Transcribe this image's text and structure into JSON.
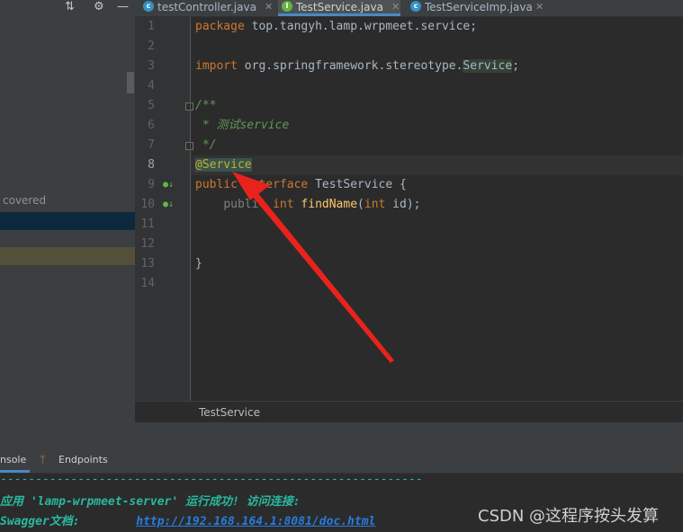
{
  "tabs": [
    {
      "label": "testController.java",
      "icon": "class-icon",
      "active": false
    },
    {
      "label": "TestService.java",
      "icon": "interface-icon",
      "active": true
    },
    {
      "label": "TestServiceImp.java",
      "icon": "class-icon",
      "active": false
    }
  ],
  "left_panel": {
    "covered_label": "covered"
  },
  "line_numbers": [
    "1",
    "2",
    "3",
    "4",
    "5",
    "6",
    "7",
    "8",
    "9",
    "10",
    "11",
    "12",
    "13",
    "14"
  ],
  "code": {
    "l1_kw": "package",
    "l1_rest": " top.tangyh.lamp.wrpmeet.service;",
    "l3_kw": "import",
    "l3_pkg": " org.springframework.stereotype.",
    "l3_cls": "Service",
    "l3_end": ";",
    "l5": "/**",
    "l6": " * 测试service",
    "l7": " */",
    "l8": "@Service",
    "l9_kw1": "public",
    "l9_kw2": " interface",
    "l9_rest": " TestService {",
    "l10_indent": "    ",
    "l10_kw1": "public",
    "l10_kw2": " int",
    "l10_fn": " findName",
    "l10_p1": "(",
    "l10_kw3": "int",
    "l10_end": " id);",
    "l13": "}"
  },
  "breadcrumb": "TestService",
  "tool_tabs": {
    "console_label": "nsole",
    "endpoints_label": "Endpoints"
  },
  "console": {
    "separator": "------------------------------------------------------------",
    "line1": "应用 'lamp-wrpmeet-server' 运行成功! 访问连接:",
    "line2_label": "Swagger文档:",
    "line2_spacing": "        ",
    "line2_url": "http://192.168.164.1:8081/doc.html"
  },
  "watermark": "CSDN @这程序按头发算",
  "colors": {
    "accent": "#4a88c7",
    "arrow": "#e8231c",
    "keyword": "#cc7832",
    "annotation": "#bbb529",
    "comment": "#629755"
  }
}
